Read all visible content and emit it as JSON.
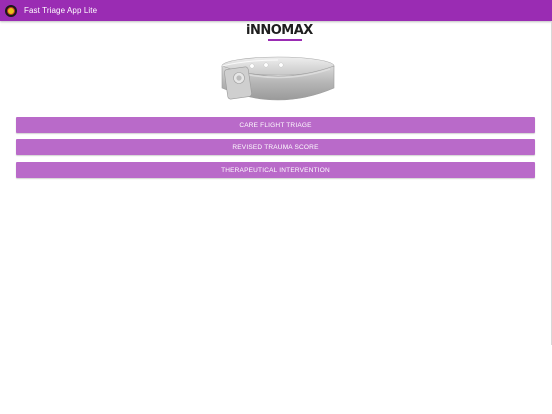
{
  "app": {
    "title": "Fast Triage App Lite"
  },
  "logo": {
    "text": "iNNOMAX"
  },
  "menu": {
    "items": [
      {
        "label": "CARE FLIGHT TRIAGE"
      },
      {
        "label": "REVISED TRAUMA SCORE"
      },
      {
        "label": "THERAPEUTICAL INTERVENTION"
      }
    ]
  },
  "colors": {
    "titlebar": "#9a2cb3",
    "button": "#b96ac9",
    "button_text": "#ffffff"
  },
  "icons": {
    "app_icon": "app-logo-icon",
    "product_image": "wristband-image"
  }
}
